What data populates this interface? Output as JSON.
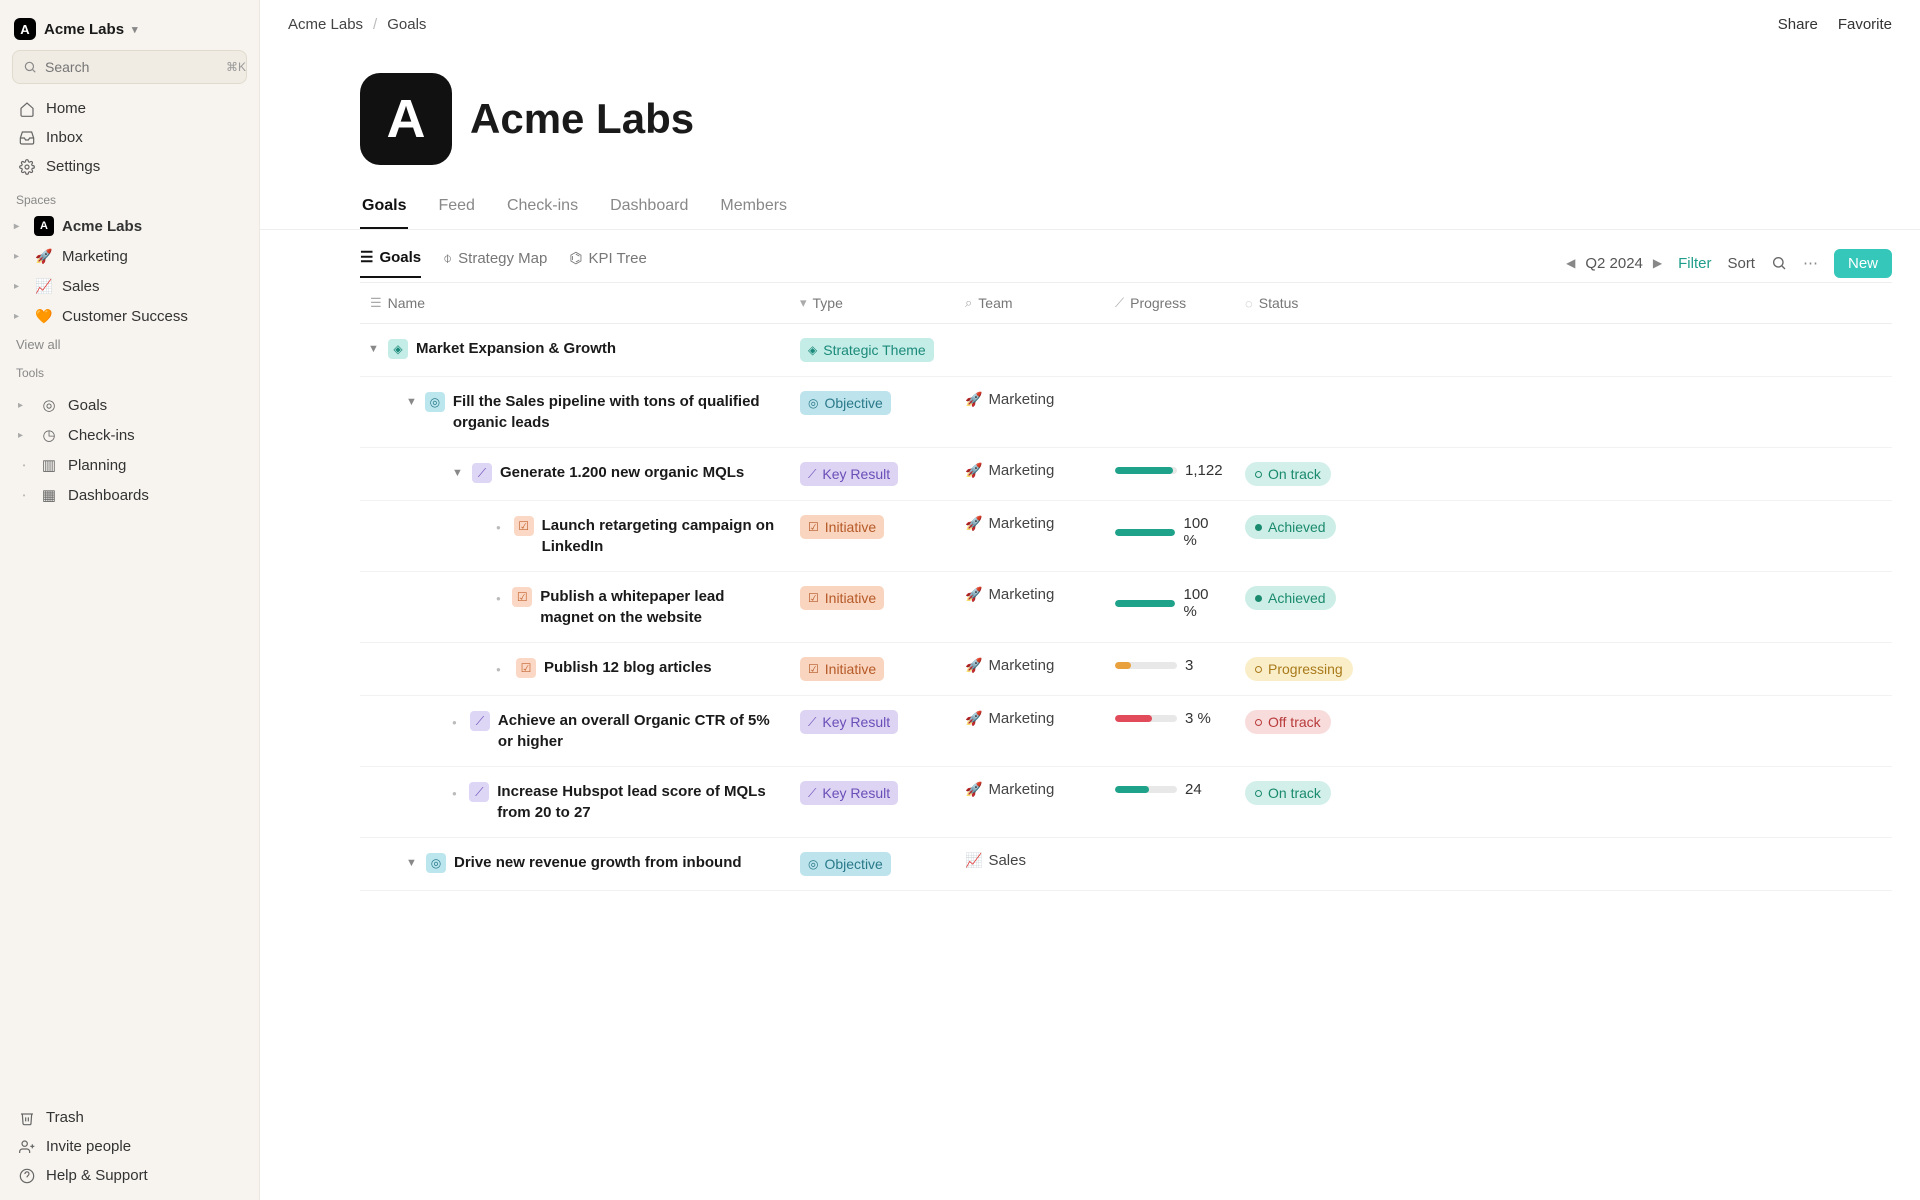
{
  "workspace": {
    "name": "Acme Labs",
    "logo_letter": "A"
  },
  "search": {
    "placeholder": "Search",
    "shortcut": "⌘K"
  },
  "nav": {
    "home": "Home",
    "inbox": "Inbox",
    "settings": "Settings"
  },
  "sections": {
    "spaces": "Spaces",
    "tools": "Tools"
  },
  "spaces": [
    {
      "label": "Acme Labs",
      "emoji": "A",
      "bold": true
    },
    {
      "label": "Marketing",
      "emoji": "🚀"
    },
    {
      "label": "Sales",
      "emoji": "📈"
    },
    {
      "label": "Customer Success",
      "emoji": "🧡"
    }
  ],
  "view_all": "View all",
  "tools": [
    {
      "label": "Goals",
      "icon": "◎",
      "expandable": true
    },
    {
      "label": "Check-ins",
      "icon": "◷",
      "expandable": true
    },
    {
      "label": "Planning",
      "icon": "▥",
      "expandable": false
    },
    {
      "label": "Dashboards",
      "icon": "▦",
      "expandable": false
    }
  ],
  "bottom": {
    "trash": "Trash",
    "invite": "Invite people",
    "help": "Help & Support"
  },
  "breadcrumb": {
    "root": "Acme Labs",
    "current": "Goals"
  },
  "top_actions": {
    "share": "Share",
    "favorite": "Favorite"
  },
  "hero": {
    "title": "Acme Labs",
    "logo_letter": "A"
  },
  "page_tabs": [
    "Goals",
    "Feed",
    "Check-ins",
    "Dashboard",
    "Members"
  ],
  "views": [
    {
      "label": "Goals",
      "icon": "☰"
    },
    {
      "label": "Strategy Map",
      "icon": "⌽"
    },
    {
      "label": "KPI Tree",
      "icon": "⌬"
    }
  ],
  "period": "Q2 2024",
  "controls": {
    "filter": "Filter",
    "sort": "Sort",
    "new": "New"
  },
  "columns": {
    "name": "Name",
    "type": "Type",
    "team": "Team",
    "progress": "Progress",
    "status": "Status"
  },
  "type_labels": {
    "theme": "Strategic Theme",
    "objective": "Objective",
    "kr": "Key Result",
    "initiative": "Initiative"
  },
  "status_labels": {
    "ontrack": "On track",
    "achieved": "Achieved",
    "progressing": "Progressing",
    "offtrack": "Off track"
  },
  "rows": [
    {
      "indent": 0,
      "caret": true,
      "icon": "theme",
      "name": "Market Expansion & Growth",
      "type": "theme"
    },
    {
      "indent": 1,
      "caret": true,
      "icon": "obj",
      "name": "Fill the Sales pipeline with tons of qualified organic leads",
      "type": "objective",
      "team": "Marketing",
      "team_emoji": "🚀"
    },
    {
      "indent": 2,
      "caret": true,
      "icon": "kr",
      "name": "Generate 1.200 new organic MQLs",
      "type": "kr",
      "team": "Marketing",
      "team_emoji": "🚀",
      "progress_pct": 94,
      "progress_val": "1,122",
      "status": "ontrack"
    },
    {
      "indent": 3,
      "caret": false,
      "icon": "init",
      "name": "Launch retargeting campaign on LinkedIn",
      "type": "initiative",
      "team": "Marketing",
      "team_emoji": "🚀",
      "progress_pct": 100,
      "progress_val": "100 %",
      "status": "achieved"
    },
    {
      "indent": 3,
      "caret": false,
      "icon": "init",
      "name": "Publish a whitepaper lead magnet on the website",
      "type": "initiative",
      "team": "Marketing",
      "team_emoji": "🚀",
      "progress_pct": 100,
      "progress_val": "100 %",
      "status": "achieved"
    },
    {
      "indent": 3,
      "caret": false,
      "icon": "init",
      "name": "Publish 12 blog articles",
      "type": "initiative",
      "team": "Marketing",
      "team_emoji": "🚀",
      "progress_pct": 25,
      "progress_color": "orange",
      "progress_val": "3",
      "status": "progressing"
    },
    {
      "indent": 2,
      "caret": false,
      "icon": "kr",
      "name": "Achieve an overall Organic CTR of 5% or higher",
      "type": "kr",
      "team": "Marketing",
      "team_emoji": "🚀",
      "progress_pct": 60,
      "progress_color": "red",
      "progress_val": "3 %",
      "status": "offtrack"
    },
    {
      "indent": 2,
      "caret": false,
      "icon": "kr",
      "name": "Increase Hubspot lead score of MQLs from 20 to 27",
      "type": "kr",
      "team": "Marketing",
      "team_emoji": "🚀",
      "progress_pct": 55,
      "progress_val": "24",
      "status": "ontrack"
    },
    {
      "indent": 1,
      "caret": true,
      "icon": "obj",
      "name": "Drive new revenue growth from inbound",
      "type": "objective",
      "team": "Sales",
      "team_emoji": "📈"
    }
  ]
}
